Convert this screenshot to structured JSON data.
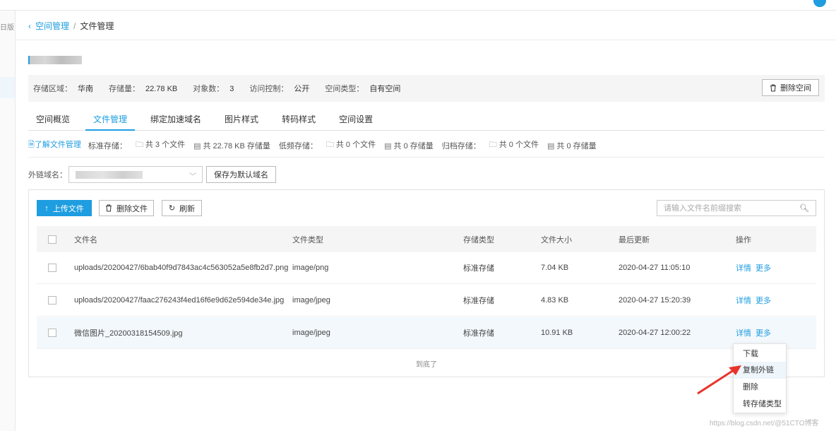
{
  "nav": {
    "left_label": "日版"
  },
  "breadcrumb": {
    "back_icon": "‹",
    "parent": "空间管理",
    "separator": "/",
    "current": "文件管理"
  },
  "info": {
    "region_label": "存储区域：",
    "region_value": "华南",
    "storage_label": "存储量：",
    "storage_value": "22.78 KB",
    "objects_label": "对象数：",
    "objects_value": "3",
    "access_label": "访问控制：",
    "access_value": "公开",
    "type_label": "空间类型：",
    "type_value": "自有空间",
    "delete_space": "删除空间"
  },
  "tabs": [
    "空间概览",
    "文件管理",
    "绑定加速域名",
    "图片样式",
    "转码样式",
    "空间设置"
  ],
  "stats": {
    "learn": "了解文件管理",
    "std_label": "标准存储：",
    "std_files": "共 3 个文件",
    "std_size": "共 22.78 KB 存储量",
    "low_label": "低频存储：",
    "low_files": "共 0 个文件",
    "low_size": "共 0 存储量",
    "arch_label": "归档存储：",
    "arch_files": "共 0 个文件",
    "arch_size": "共 0 存储量"
  },
  "domain": {
    "label": "外链域名：",
    "save_default": "保存为默认域名"
  },
  "toolbar": {
    "upload": "上传文件",
    "delete": "删除文件",
    "refresh": "刷新",
    "search_placeholder": "请输入文件名前缀搜索"
  },
  "table": {
    "headers": {
      "name": "文件名",
      "type": "文件类型",
      "storage": "存储类型",
      "size": "文件大小",
      "updated": "最后更新",
      "ops": "操作"
    },
    "rows": [
      {
        "name": "uploads/20200427/6bab40f9d7843ac4c563052a5e8fb2d7.png",
        "type": "image/png",
        "storage": "标准存储",
        "size": "7.04 KB",
        "updated": "2020-04-27 11:05:10",
        "detail": "详情",
        "more": "更多"
      },
      {
        "name": "uploads/20200427/faac276243f4ed16f6e9d62e594de34e.jpg",
        "type": "image/jpeg",
        "storage": "标准存储",
        "size": "4.83 KB",
        "updated": "2020-04-27 15:20:39",
        "detail": "详情",
        "more": "更多"
      },
      {
        "name": "微信图片_20200318154509.jpg",
        "type": "image/jpeg",
        "storage": "标准存储",
        "size": "10.91 KB",
        "updated": "2020-04-27 12:00:22",
        "detail": "详情",
        "more": "更多"
      }
    ],
    "end_text": "到底了"
  },
  "dropdown": {
    "items": [
      "下载",
      "复制外链",
      "删除",
      "转存储类型"
    ]
  },
  "watermark": "https://blog.csdn.net/@51CTO博客",
  "colors": {
    "accent": "#1e9de0",
    "annotation_arrow": "#e8332a"
  }
}
